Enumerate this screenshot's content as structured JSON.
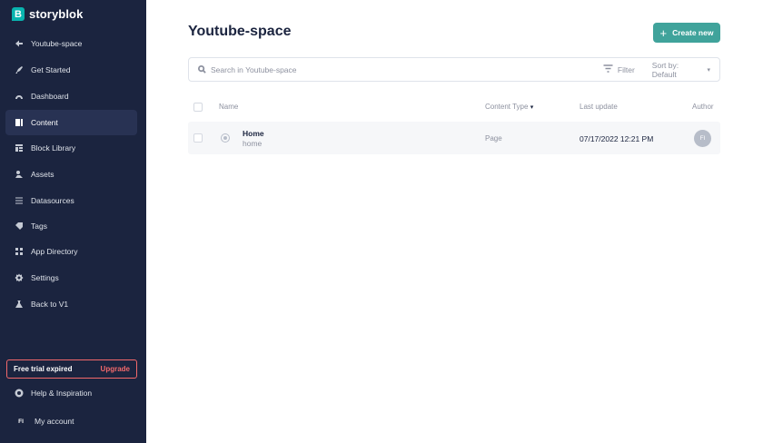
{
  "brand": {
    "name": "storyblok",
    "mark": "B"
  },
  "sidebar": {
    "back_label": "Youtube-space",
    "items": [
      {
        "label": "Get Started",
        "icon": "rocket-icon"
      },
      {
        "label": "Dashboard",
        "icon": "dashboard-icon"
      },
      {
        "label": "Content",
        "icon": "content-icon",
        "active": true
      },
      {
        "label": "Block Library",
        "icon": "block-library-icon"
      },
      {
        "label": "Assets",
        "icon": "assets-icon"
      },
      {
        "label": "Datasources",
        "icon": "datasources-icon"
      },
      {
        "label": "Tags",
        "icon": "tags-icon"
      },
      {
        "label": "App Directory",
        "icon": "app-directory-icon"
      },
      {
        "label": "Settings",
        "icon": "gear-icon"
      },
      {
        "label": "Back to V1",
        "icon": "flask-icon"
      }
    ],
    "trial": {
      "text": "Free trial expired",
      "action": "Upgrade"
    },
    "help_label": "Help & Inspiration",
    "account": {
      "initials": "FI",
      "label": "My account"
    }
  },
  "main": {
    "title": "Youtube-space",
    "create_label": "Create new",
    "search": {
      "placeholder": "Search in Youtube-space"
    },
    "filter_label": "Filter",
    "sort_label": "Sort by: Default",
    "columns": {
      "name": "Name",
      "content_type": "Content Type",
      "last_update": "Last update",
      "author": "Author"
    },
    "rows": [
      {
        "title": "Home",
        "slug": "home",
        "content_type": "Page",
        "last_update": "07/17/2022 12:21 PM",
        "author_initials": "FI"
      }
    ]
  },
  "colors": {
    "sidebar_bg": "#1b243f",
    "accent": "#40a39b",
    "brand": "#09b3af",
    "warning": "#f3696b"
  }
}
